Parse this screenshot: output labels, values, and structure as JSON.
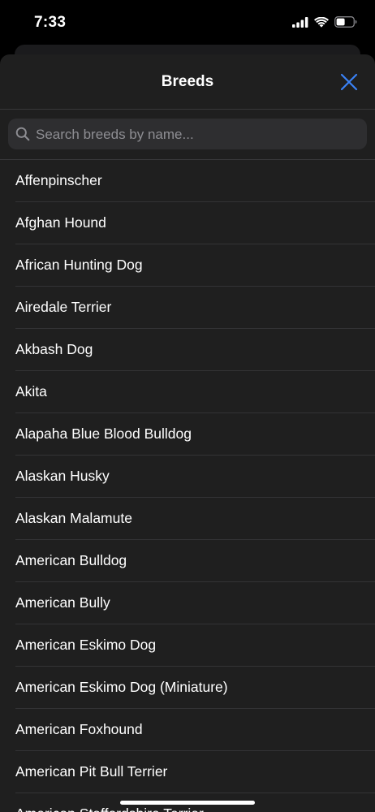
{
  "status_bar": {
    "time": "7:33",
    "icons": [
      "cellular-signal-icon",
      "wifi-icon",
      "battery-icon"
    ]
  },
  "sheet": {
    "title": "Breeds",
    "close_icon": "close-icon"
  },
  "search": {
    "placeholder": "Search breeds by name...",
    "value": ""
  },
  "breeds": [
    "Affenpinscher",
    "Afghan Hound",
    "African Hunting Dog",
    "Airedale Terrier",
    "Akbash Dog",
    "Akita",
    "Alapaha Blue Blood Bulldog",
    "Alaskan Husky",
    "Alaskan Malamute",
    "American Bulldog",
    "American Bully",
    "American Eskimo Dog",
    "American Eskimo Dog (Miniature)",
    "American Foxhound",
    "American Pit Bull Terrier",
    "American Staffordshire Terrier"
  ],
  "colors": {
    "accent": "#3a82f7",
    "sheet_background": "#1f1f1f",
    "search_background": "#2e2e30",
    "placeholder": "#8e8e93"
  }
}
